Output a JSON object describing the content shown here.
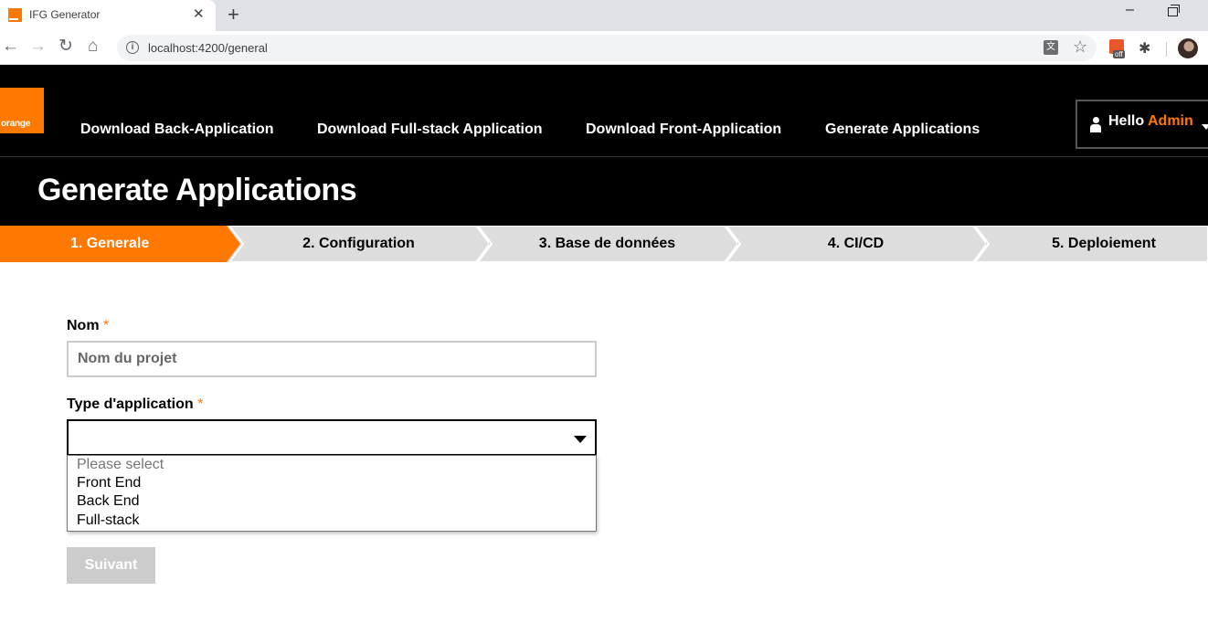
{
  "browser": {
    "tab_title": "IFG Generator",
    "tab_close": "✕",
    "new_tab": "+",
    "url": "localhost:4200/general",
    "info": "i",
    "translate": "文",
    "star": "☆",
    "ext_badge": "off",
    "ext2": "✱",
    "nav": {
      "back": "←",
      "forward": "→",
      "reload": "↻",
      "home": "⌂"
    },
    "window": {
      "minimize": "–"
    }
  },
  "header": {
    "logo_text": "orange",
    "nav": [
      {
        "label": "Download Back-Application"
      },
      {
        "label": "Download Full-stack Application"
      },
      {
        "label": "Download Front-Application"
      },
      {
        "label": "Generate Applications"
      }
    ],
    "user": {
      "greeting": "Hello",
      "name": "Admin"
    },
    "page_title": "Generate Applications"
  },
  "stepper": {
    "active_color": "#ff7900",
    "inactive_color": "#dddddd",
    "steps": [
      {
        "label": "1. Generale",
        "active": true
      },
      {
        "label": "2. Configuration",
        "active": false
      },
      {
        "label": "3. Base de données",
        "active": false
      },
      {
        "label": "4. CI/CD",
        "active": false
      },
      {
        "label": "5. Deploiement",
        "active": false
      }
    ]
  },
  "form": {
    "name_label": "Nom",
    "required_mark": "*",
    "name_placeholder": "Nom du projet",
    "name_value": "",
    "type_label": "Type d'application",
    "type_value": "",
    "type_options": [
      "Please select",
      "Front End",
      "Back End",
      "Full-stack"
    ],
    "next_label": "Suivant"
  }
}
